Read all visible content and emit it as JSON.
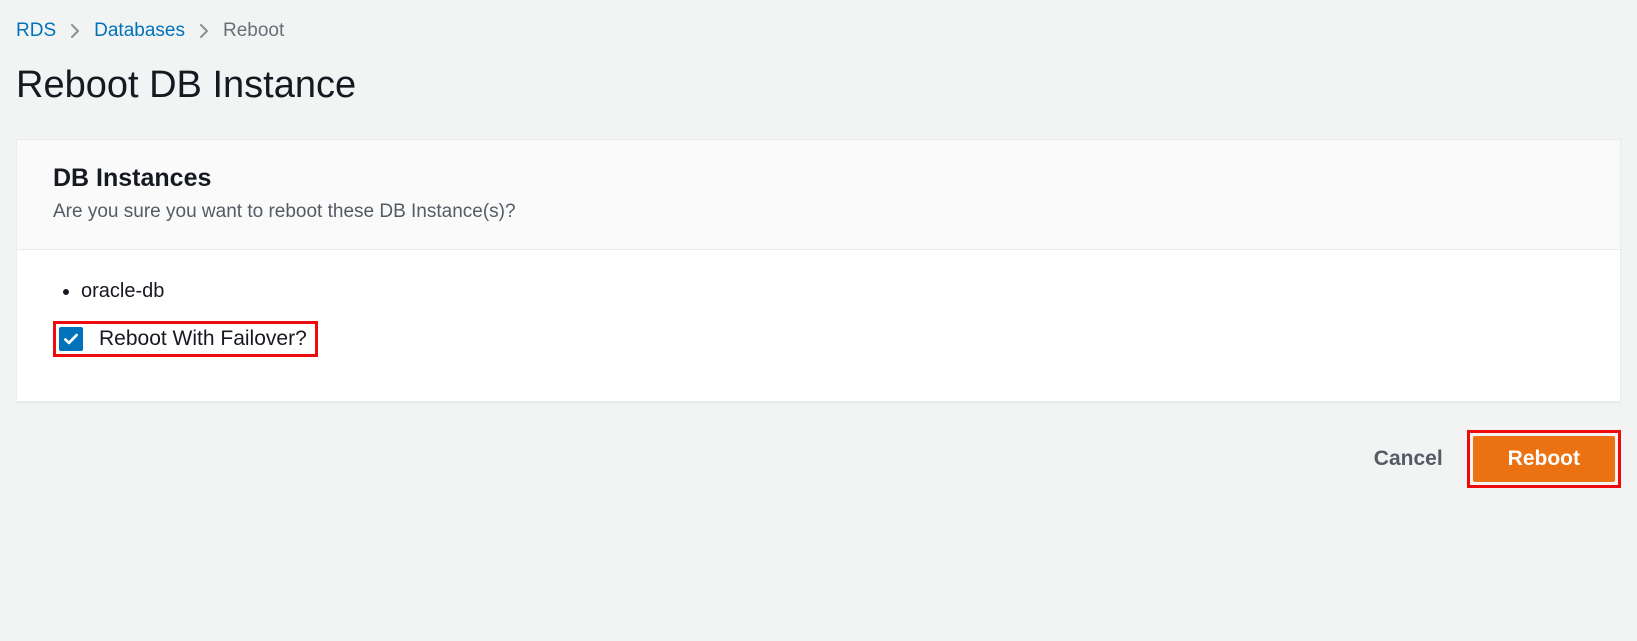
{
  "breadcrumb": {
    "items": [
      {
        "label": "RDS"
      },
      {
        "label": "Databases"
      }
    ],
    "current": "Reboot"
  },
  "page": {
    "title": "Reboot DB Instance"
  },
  "panel": {
    "heading": "DB Instances",
    "subheading": "Are you sure you want to reboot these DB Instance(s)?",
    "instances": [
      "oracle-db"
    ],
    "failover_label": "Reboot With Failover?",
    "failover_checked": true
  },
  "actions": {
    "cancel": "Cancel",
    "confirm": "Reboot"
  }
}
